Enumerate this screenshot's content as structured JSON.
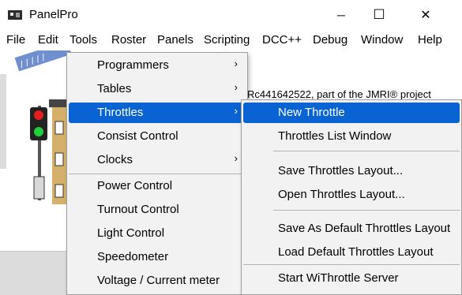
{
  "window": {
    "title": "PanelPro",
    "minimize_glyph": "─",
    "maximize_glyph": "☐",
    "close_glyph": "✕"
  },
  "menubar": [
    "File",
    "Edit",
    "Tools",
    "Roster",
    "Panels",
    "Scripting",
    "DCC++",
    "Debug",
    "Window",
    "Help"
  ],
  "background_text": "Rc441642522, part of the JMRI® project",
  "tools_menu": {
    "items": [
      "Programmers",
      "Tables",
      "Throttles",
      "Consist Control",
      "Clocks",
      "Power Control",
      "Turnout Control",
      "Light Control",
      "Speedometer",
      "Voltage / Current meter"
    ],
    "submenu_arrow": "›"
  },
  "throttles_menu": {
    "items": [
      "New Throttle",
      "Throttles List Window",
      "Save Throttles Layout...",
      "Open Throttles Layout...",
      "Save As Default Throttles Layout",
      "Load Default Throttles Layout",
      "Start WiThrottle Server"
    ]
  },
  "colors": {
    "highlight": "#0a63d3",
    "signal_red": "#e41e1e",
    "signal_green": "#1fcf3c"
  }
}
